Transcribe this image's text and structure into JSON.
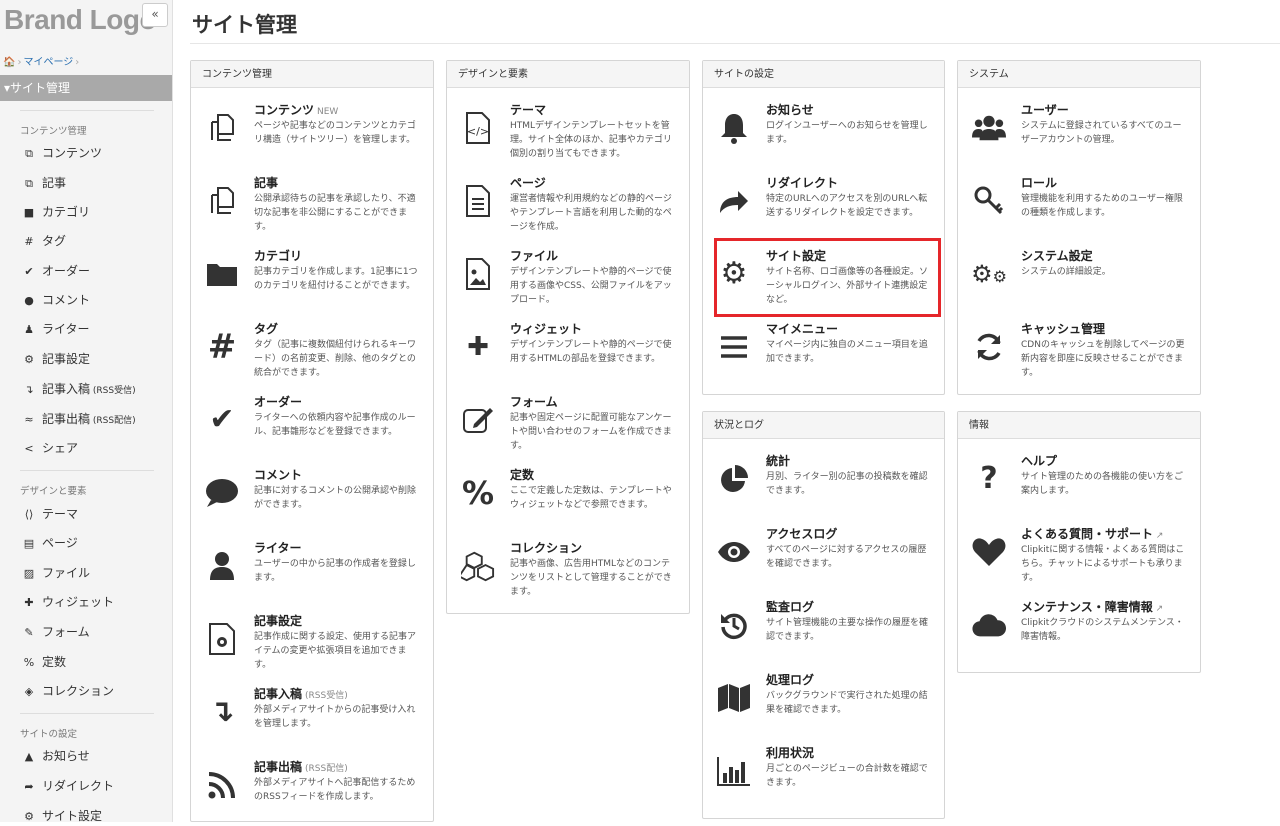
{
  "brand": "Brand Logo",
  "collapse_label": "«",
  "breadcrumb": {
    "home": "🏠",
    "sep1": "›",
    "item1": "マイページ",
    "sep2": "›"
  },
  "page_title": "サイト管理",
  "sidebar": {
    "active": "▾サイト管理",
    "sections": [
      {
        "label": "コンテンツ管理",
        "items": [
          {
            "icon": "⧉",
            "label": "コンテンツ"
          },
          {
            "icon": "⧉",
            "label": "記事"
          },
          {
            "icon": "■",
            "label": "カテゴリ"
          },
          {
            "icon": "#",
            "label": "タグ"
          },
          {
            "icon": "✔",
            "label": "オーダー"
          },
          {
            "icon": "●",
            "label": "コメント"
          },
          {
            "icon": "♟",
            "label": "ライター"
          },
          {
            "icon": "⚙",
            "label": "記事設定"
          },
          {
            "icon": "↴",
            "label": "記事入稿",
            "suffix": "(RSS受信)"
          },
          {
            "icon": "≈",
            "label": "記事出稿",
            "suffix": "(RSS配信)"
          },
          {
            "icon": "<",
            "label": "シェア"
          }
        ]
      },
      {
        "label": "デザインと要素",
        "items": [
          {
            "icon": "⟨⟩",
            "label": "テーマ"
          },
          {
            "icon": "▤",
            "label": "ページ"
          },
          {
            "icon": "▨",
            "label": "ファイル"
          },
          {
            "icon": "✚",
            "label": "ウィジェット"
          },
          {
            "icon": "✎",
            "label": "フォーム"
          },
          {
            "icon": "%",
            "label": "定数"
          },
          {
            "icon": "◈",
            "label": "コレクション"
          }
        ]
      },
      {
        "label": "サイトの設定",
        "items": [
          {
            "icon": "▲",
            "label": "お知らせ"
          },
          {
            "icon": "➦",
            "label": "リダイレクト"
          },
          {
            "icon": "⚙",
            "label": "サイト設定"
          }
        ]
      }
    ]
  },
  "panels": {
    "content": {
      "title": "コンテンツ管理",
      "items": [
        {
          "icon": "copy-icon",
          "title": "コンテンツ",
          "badge": "NEW",
          "desc": "ページや記事などのコンテンツとカテゴリ構造（サイトツリー）を管理します。"
        },
        {
          "icon": "copy-icon",
          "title": "記事",
          "desc": "公開承認待ちの記事を承認したり、不適切な記事を非公開にすることができます。"
        },
        {
          "icon": "folder-icon",
          "title": "カテゴリ",
          "desc": "記事カテゴリを作成します。1記事に1つのカテゴリを紐付けることができます。"
        },
        {
          "icon": "hash-icon",
          "title": "タグ",
          "desc": "タグ（記事に複数個紐付けられるキーワード）の名前変更、削除、他のタグとの統合ができます。"
        },
        {
          "icon": "check-icon",
          "title": "オーダー",
          "desc": "ライターへの依頼内容や記事作成のルール、記事雛形などを登録できます。"
        },
        {
          "icon": "comment-icon",
          "title": "コメント",
          "desc": "記事に対するコメントの公開承認や削除ができます。"
        },
        {
          "icon": "user-icon",
          "title": "ライター",
          "desc": "ユーザーの中から記事の作成者を登録します。"
        },
        {
          "icon": "file-gear-icon",
          "title": "記事設定",
          "desc": "記事作成に関する設定、使用する記事アイテムの変更や拡張項目を追加できます。"
        },
        {
          "icon": "import-icon",
          "title": "記事入稿",
          "badge": "(RSS受信)",
          "desc": "外部メディアサイトからの記事受け入れを管理します。"
        },
        {
          "icon": "rss-icon",
          "title": "記事出稿",
          "badge": "(RSS配信)",
          "desc": "外部メディアサイトへ記事配信するためのRSSフィードを作成します。"
        }
      ]
    },
    "design": {
      "title": "デザインと要素",
      "items": [
        {
          "icon": "code-file-icon",
          "title": "テーマ",
          "desc": "HTMLデザインテンプレートセットを管理。サイト全体のほか、記事やカテゴリ個別の割り当てもできます。"
        },
        {
          "icon": "page-icon",
          "title": "ページ",
          "desc": "運営者情報や利用規約などの静的ページやテンプレート言語を利用した動的なページを作成。"
        },
        {
          "icon": "image-file-icon",
          "title": "ファイル",
          "desc": "デザインテンプレートや静的ページで使用する画像やCSS、公開ファイルをアップロード。"
        },
        {
          "icon": "puzzle-icon",
          "title": "ウィジェット",
          "desc": "デザインテンプレートや静的ページで使用するHTMLの部品を登録できます。"
        },
        {
          "icon": "form-icon",
          "title": "フォーム",
          "desc": "記事や固定ページに配置可能なアンケートや問い合わせのフォームを作成できます。"
        },
        {
          "icon": "percent-icon",
          "title": "定数",
          "desc": "ここで定義した定数は、テンプレートやウィジェットなどで参照できます。"
        },
        {
          "icon": "cubes-icon",
          "title": "コレクション",
          "desc": "記事や画像、広告用HTMLなどのコンテンツをリストとして管理することができます。"
        }
      ]
    },
    "site": {
      "title": "サイトの設定",
      "items": [
        {
          "icon": "bell-icon",
          "title": "お知らせ",
          "desc": "ログインユーザーへのお知らせを管理します。"
        },
        {
          "icon": "redirect-icon",
          "title": "リダイレクト",
          "desc": "特定のURLへのアクセスを別のURLへ転送するリダイレクトを設定できます。"
        },
        {
          "icon": "gear-icon",
          "title": "サイト設定",
          "desc": "サイト名称、ロゴ画像等の各種設定。ソーシャルログイン、外部サイト連携設定など。"
        },
        {
          "icon": "menu-icon",
          "title": "マイメニュー",
          "desc": "マイページ内に独自のメニュー項目を追加できます。"
        }
      ]
    },
    "system": {
      "title": "システム",
      "items": [
        {
          "icon": "users-icon",
          "title": "ユーザー",
          "desc": "システムに登録されているすべてのユーザーアカウントの管理。"
        },
        {
          "icon": "key-icon",
          "title": "ロール",
          "desc": "管理機能を利用するためのユーザー権限の種類を作成します。"
        },
        {
          "icon": "gears-icon",
          "title": "システム設定",
          "desc": "システムの詳細設定。"
        },
        {
          "icon": "refresh-icon",
          "title": "キャッシュ管理",
          "desc": "CDNのキャッシュを削除してページの更新内容を即座に反映させることができます。"
        }
      ]
    },
    "logs": {
      "title": "状況とログ",
      "items": [
        {
          "icon": "pie-icon",
          "title": "統計",
          "desc": "月別、ライター別の記事の投稿数を確認できます。"
        },
        {
          "icon": "eye-icon",
          "title": "アクセスログ",
          "desc": "すべてのページに対するアクセスの履歴を確認できます。"
        },
        {
          "icon": "history-icon",
          "title": "監査ログ",
          "desc": "サイト管理機能の主要な操作の履歴を確認できます。"
        },
        {
          "icon": "map-icon",
          "title": "処理ログ",
          "desc": "バックグラウンドで実行された処理の結果を確認できます。"
        },
        {
          "icon": "bar-chart-icon",
          "title": "利用状況",
          "desc": "月ごとのページビューの合計数を確認できます。"
        }
      ]
    },
    "info": {
      "title": "情報",
      "items": [
        {
          "icon": "question-icon",
          "title": "ヘルプ",
          "desc": "サイト管理のための各機能の使い方をご案内します。"
        },
        {
          "icon": "heart-icon",
          "title": "よくある質問・サポート",
          "ext": "↗",
          "desc": "Clipkitに関する情報・よくある質問はこちら。チャットによるサポートも承ります。"
        },
        {
          "icon": "cloud-icon",
          "title": "メンテナンス・障害情報",
          "ext": "↗",
          "desc": "Clipkitクラウドのシステムメンテンス・障害情報。"
        }
      ]
    }
  }
}
